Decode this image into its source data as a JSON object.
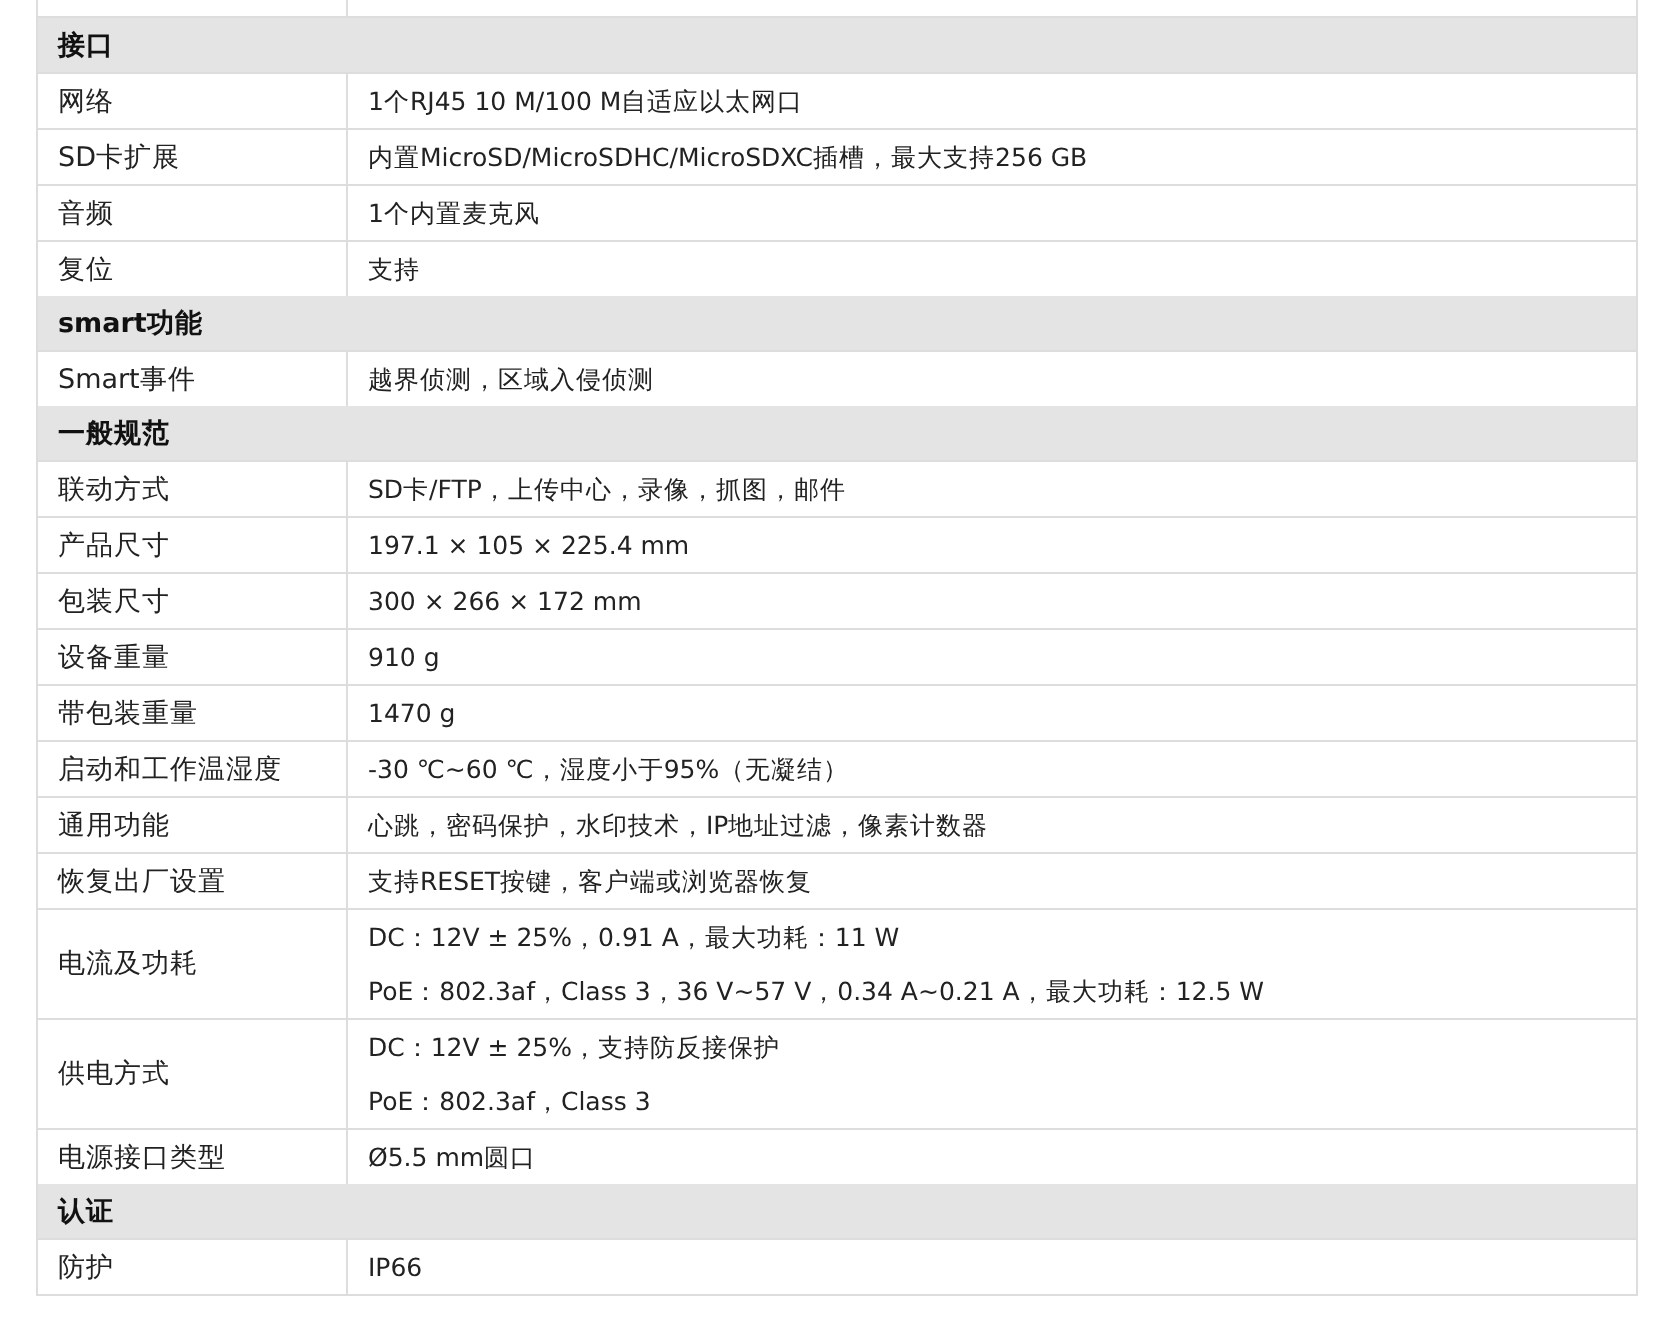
{
  "sections": [
    {
      "title": "接口",
      "rows": [
        {
          "label": "网络",
          "values": [
            "1个RJ45 10 M/100 M自适应以太网口"
          ]
        },
        {
          "label": "SD卡扩展",
          "values": [
            "内置MicroSD/MicroSDHC/MicroSDXC插槽，最大支持256 GB"
          ]
        },
        {
          "label": "音频",
          "values": [
            "1个内置麦克风"
          ]
        },
        {
          "label": "复位",
          "values": [
            "支持"
          ]
        }
      ]
    },
    {
      "title": "smart功能",
      "rows": [
        {
          "label": "Smart事件",
          "values": [
            "越界侦测，区域入侵侦测"
          ]
        }
      ]
    },
    {
      "title": "一般规范",
      "rows": [
        {
          "label": "联动方式",
          "values": [
            "SD卡/FTP，上传中心，录像，抓图，邮件"
          ]
        },
        {
          "label": "产品尺寸",
          "values": [
            "197.1 × 105 × 225.4 mm"
          ]
        },
        {
          "label": "包装尺寸",
          "values": [
            "300 × 266 × 172 mm"
          ]
        },
        {
          "label": "设备重量",
          "values": [
            "910 g"
          ]
        },
        {
          "label": "带包装重量",
          "values": [
            "1470 g"
          ]
        },
        {
          "label": "启动和工作温湿度",
          "values": [
            "-30 ℃~60 ℃，湿度小于95%（无凝结）"
          ]
        },
        {
          "label": "通用功能",
          "values": [
            "心跳，密码保护，水印技术，IP地址过滤，像素计数器"
          ]
        },
        {
          "label": "恢复出厂设置",
          "values": [
            "支持RESET按键，客户端或浏览器恢复"
          ]
        },
        {
          "label": "电流及功耗",
          "values": [
            "DC：12V ± 25%，0.91 A，最大功耗：11 W",
            "PoE：802.3af，Class 3，36 V~57 V，0.34 A~0.21 A，最大功耗：12.5 W"
          ]
        },
        {
          "label": "供电方式",
          "values": [
            "DC：12V ± 25%，支持防反接保护",
            "PoE：802.3af，Class 3"
          ]
        },
        {
          "label": "电源接口类型",
          "values": [
            "Ø5.5 mm圆口"
          ]
        }
      ]
    },
    {
      "title": "认证",
      "rows": [
        {
          "label": "防护",
          "values": [
            "IP66"
          ]
        }
      ]
    }
  ]
}
